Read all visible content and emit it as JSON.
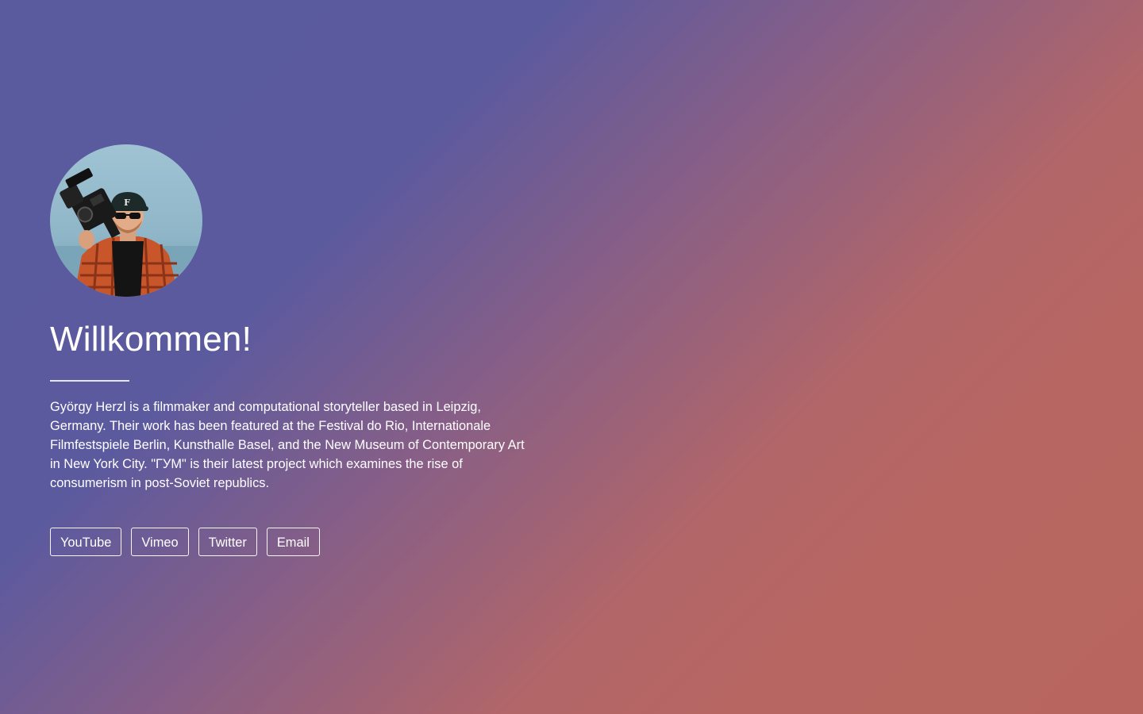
{
  "profile": {
    "avatar": "photo-of-person-holding-film-camera",
    "heading": "Willkommen!",
    "bio": "György Herzl is a filmmaker and computational storyteller based in Leipzig, Germany. Their work has been featured at the Festival do Rio, Internationale Filmfestspiele Berlin, Kunsthalle Basel, and the New Museum of Contemporary Art in New York City. \"ГУМ\" is their latest project which examines the rise of consumerism in post-Soviet republics."
  },
  "links": [
    {
      "label": "YouTube"
    },
    {
      "label": "Vimeo"
    },
    {
      "label": "Twitter"
    },
    {
      "label": "Email"
    }
  ],
  "colors": {
    "gradient_start": "#5a5a9e",
    "gradient_end": "#b8655f",
    "text": "#ffffff"
  }
}
